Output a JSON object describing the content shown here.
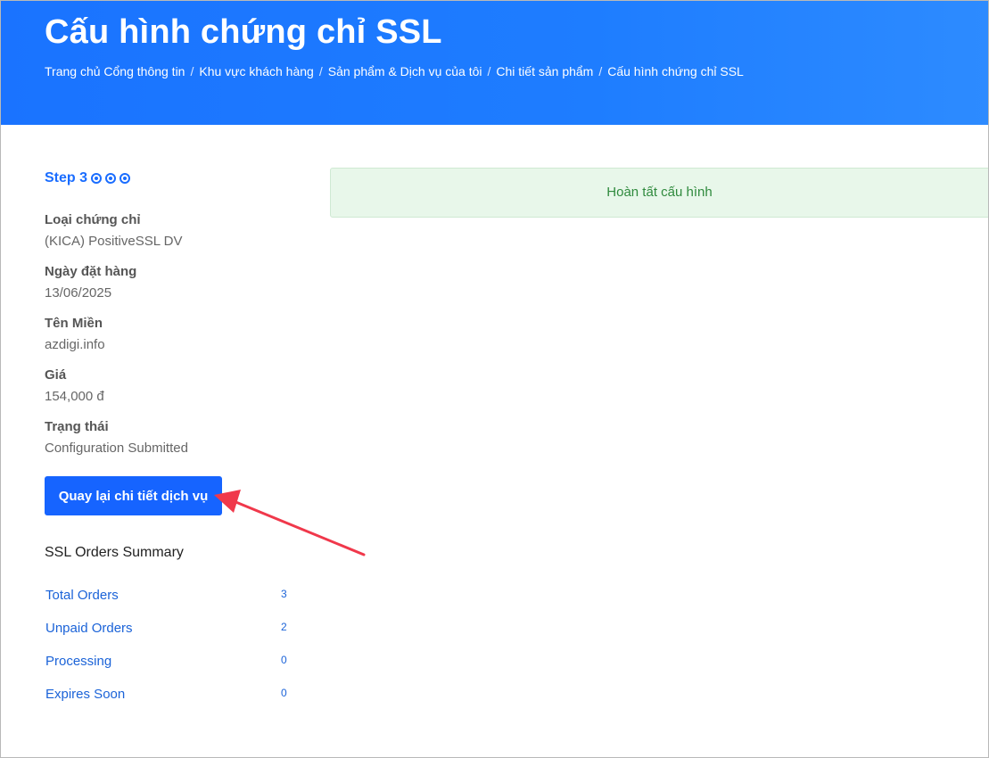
{
  "header": {
    "title": "Cấu hình chứng chỉ SSL",
    "breadcrumb": [
      "Trang chủ Cổng thông tin",
      "Khu vực khách hàng",
      "Sản phẩm & Dịch vụ của tôi",
      "Chi tiết sản phẩm",
      "Cấu hình chứng chỉ SSL"
    ],
    "separator": "/"
  },
  "step": {
    "label": "Step 3"
  },
  "details": [
    {
      "label": "Loại chứng chỉ",
      "value": "(KICA) PositiveSSL DV"
    },
    {
      "label": "Ngày đặt hàng",
      "value": "13/06/2025"
    },
    {
      "label": "Tên Miền",
      "value": "azdigi.info"
    },
    {
      "label": "Giá",
      "value": "154,000 đ"
    },
    {
      "label": "Trạng thái",
      "value": "Configuration Submitted"
    }
  ],
  "back_button": "Quay lại chi tiết dịch vụ",
  "summary": {
    "title": "SSL Orders Summary",
    "items": [
      {
        "label": "Total Orders",
        "count": "3"
      },
      {
        "label": "Unpaid Orders",
        "count": "2"
      },
      {
        "label": "Processing",
        "count": "0"
      },
      {
        "label": "Expires Soon",
        "count": "0"
      }
    ]
  },
  "alert": {
    "message": "Hoàn tất cấu hình"
  },
  "colors": {
    "primary": "#1664ff",
    "success_bg": "#e8f7ea",
    "success_text": "#2f8a3d",
    "annotation_arrow": "#f0384b"
  },
  "icons": {
    "step_indicator": "radio-dot-icon",
    "annotation": "red-arrow-icon"
  }
}
